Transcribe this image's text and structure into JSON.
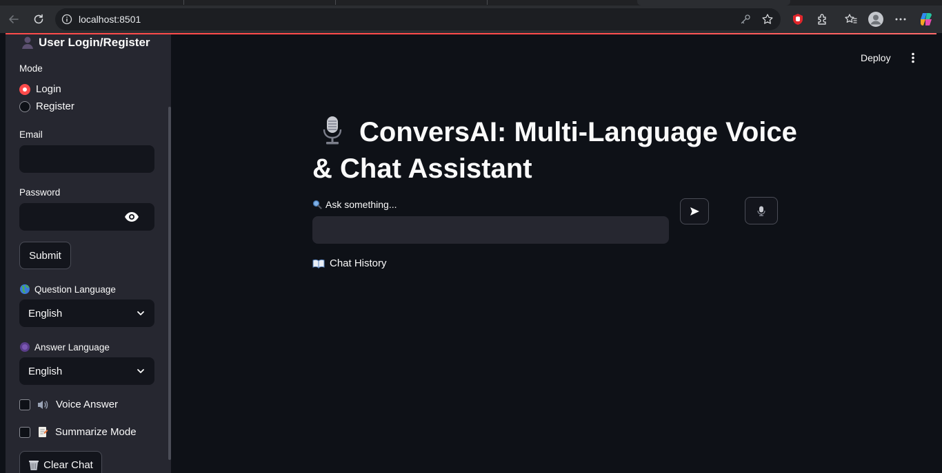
{
  "browser": {
    "url": "localhost:8501"
  },
  "header": {
    "deploy_label": "Deploy"
  },
  "sidebar": {
    "title": "User Login/Register",
    "mode_label": "Mode",
    "mode_options": [
      "Login",
      "Register"
    ],
    "mode_selected": "Login",
    "email_label": "Email",
    "email_value": "",
    "password_label": "Password",
    "password_value": "",
    "submit_label": "Submit",
    "question_language_label": "Question Language",
    "question_language_value": "English",
    "answer_language_label": "Answer Language",
    "answer_language_value": "English",
    "voice_answer_label": "Voice Answer",
    "summarize_mode_label": "Summarize Mode",
    "clear_chat_label": "Clear Chat"
  },
  "main": {
    "title": "ConversAI: Multi-Language Voice & Chat Assistant",
    "ask_label": "Ask something...",
    "ask_value": "",
    "send_icon": "send-arrow-icon",
    "mic_icon": "microphone-icon",
    "chat_history_label": "Chat History"
  },
  "colors": {
    "accent": "#ff4b4b",
    "background": "#0e1117",
    "sidebar": "#262730"
  }
}
